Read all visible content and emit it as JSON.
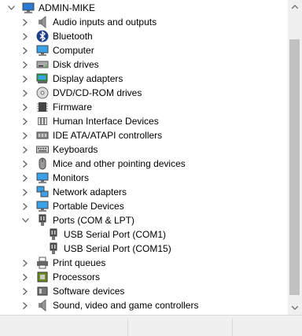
{
  "tree": {
    "root": {
      "label": "ADMIN-MIKE",
      "icon": "computer-root-icon",
      "expander": "expanded"
    },
    "categories": [
      {
        "label": "Audio inputs and outputs",
        "icon": "speaker-icon",
        "expander": "collapsed"
      },
      {
        "label": "Bluetooth",
        "icon": "bluetooth-icon",
        "expander": "collapsed"
      },
      {
        "label": "Computer",
        "icon": "monitor-icon",
        "expander": "collapsed"
      },
      {
        "label": "Disk drives",
        "icon": "disk-drive-icon",
        "expander": "collapsed"
      },
      {
        "label": "Display adapters",
        "icon": "display-adapter-icon",
        "expander": "collapsed"
      },
      {
        "label": "DVD/CD-ROM drives",
        "icon": "dvd-drive-icon",
        "expander": "collapsed"
      },
      {
        "label": "Firmware",
        "icon": "chip-icon",
        "expander": "collapsed"
      },
      {
        "label": "Human Interface Devices",
        "icon": "hid-icon",
        "expander": "collapsed"
      },
      {
        "label": "IDE ATA/ATAPI controllers",
        "icon": "ide-controller-icon",
        "expander": "collapsed"
      },
      {
        "label": "Keyboards",
        "icon": "keyboard-icon",
        "expander": "collapsed"
      },
      {
        "label": "Mice and other pointing devices",
        "icon": "mouse-icon",
        "expander": "collapsed"
      },
      {
        "label": "Monitors",
        "icon": "monitor-icon",
        "expander": "collapsed"
      },
      {
        "label": "Network adapters",
        "icon": "network-icon",
        "expander": "collapsed"
      },
      {
        "label": "Portable Devices",
        "icon": "portable-device-icon",
        "expander": "collapsed"
      },
      {
        "label": "Ports (COM & LPT)",
        "icon": "port-icon",
        "expander": "expanded",
        "children": [
          {
            "label": "USB Serial Port (COM1)",
            "icon": "port-icon"
          },
          {
            "label": "USB Serial Port (COM15)",
            "icon": "port-icon"
          }
        ]
      },
      {
        "label": "Print queues",
        "icon": "printer-icon",
        "expander": "collapsed"
      },
      {
        "label": "Processors",
        "icon": "processor-icon",
        "expander": "collapsed"
      },
      {
        "label": "Software devices",
        "icon": "software-device-icon",
        "expander": "collapsed"
      },
      {
        "label": "Sound, video and game controllers",
        "icon": "speaker-icon",
        "expander": "collapsed"
      },
      {
        "label": "",
        "icon": "storage-controller-icon",
        "expander": "collapsed"
      }
    ]
  },
  "scrollbar": {
    "orientation": "vertical",
    "position_fraction": 0.09,
    "visible_fraction": 0.9
  },
  "colors": {
    "background": "#ffffff",
    "chrome": "#f0f0f0",
    "scroll_thumb": "#c1c1c1",
    "expander": "#5a5a5a"
  }
}
